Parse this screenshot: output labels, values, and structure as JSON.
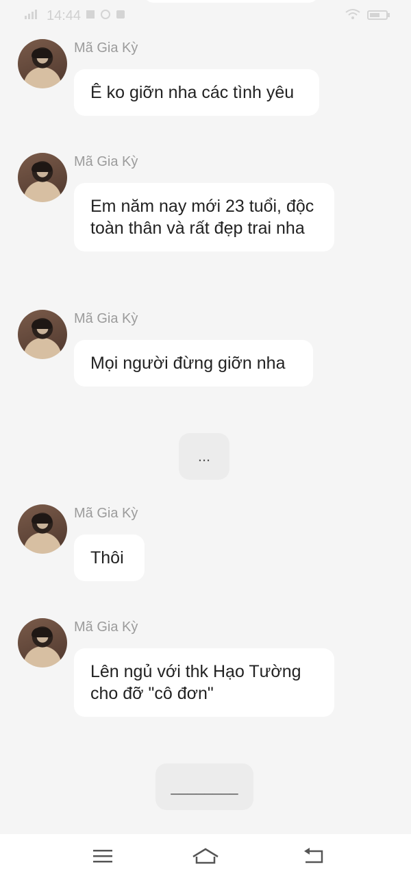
{
  "status_bar": {
    "time": "14:44"
  },
  "messages": [
    {
      "sender": "Mã Gia Kỳ",
      "text": "Ê ko giỡn nha các tình yêu"
    },
    {
      "sender": "Mã Gia Kỳ",
      "text": "Em năm nay mới 23 tuổi, độc toàn thân và rất đẹp trai nha"
    },
    {
      "sender": "Mã Gia Kỳ",
      "text": "Mọi người đừng giỡn nha"
    },
    {
      "sender": "Mã Gia Kỳ",
      "text": "Thôi"
    },
    {
      "sender": "Mã Gia Kỳ",
      "text": "Lên ngủ với thk Hạo Tường cho đỡ \"cô đơn\""
    }
  ],
  "system_messages": [
    {
      "text": "..."
    },
    {
      "text": "________"
    }
  ],
  "nav": {
    "menu_icon": "menu-icon",
    "home_icon": "home-icon",
    "back_icon": "back-icon"
  }
}
